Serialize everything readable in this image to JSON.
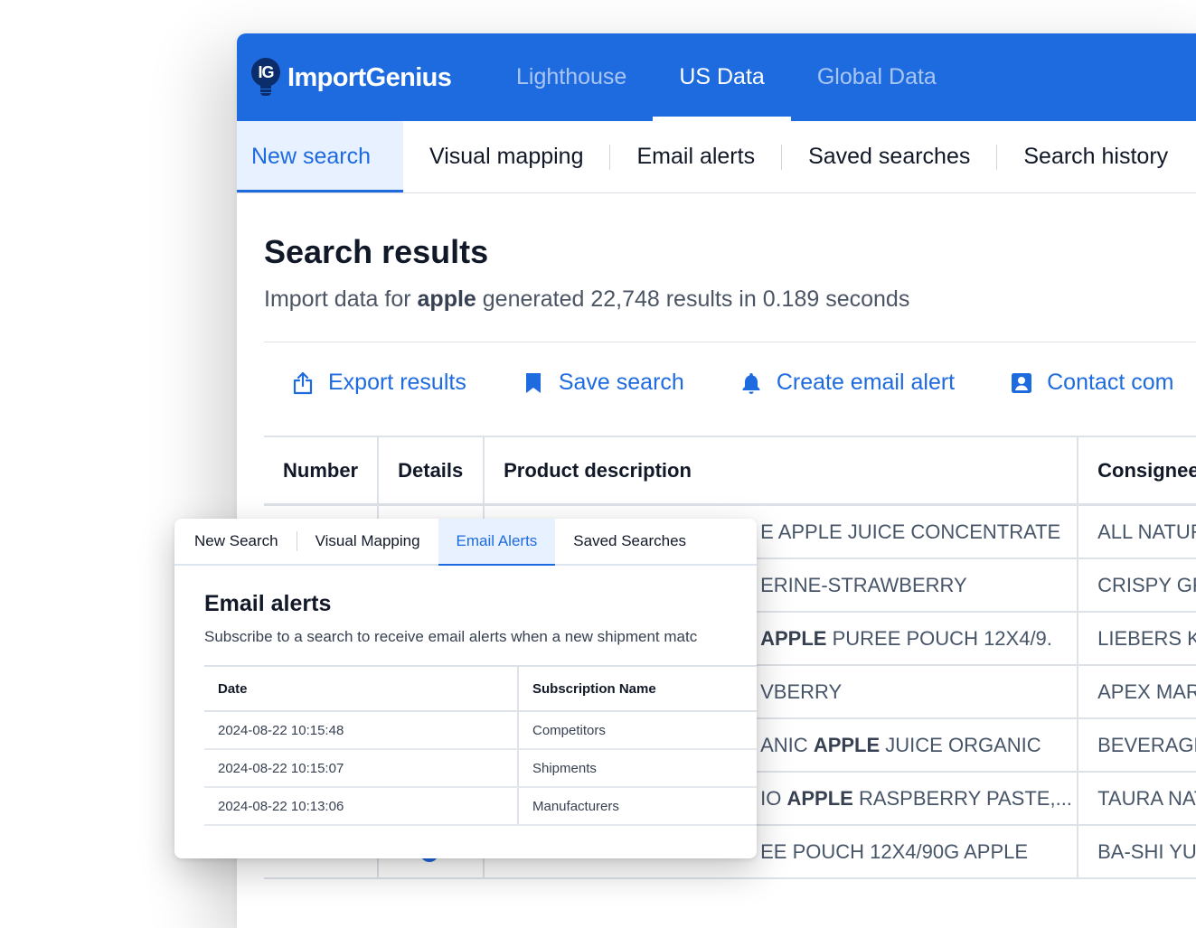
{
  "app": {
    "brand": "ImportGenius",
    "logo_mark": "IG",
    "accent_color": "#1e6be0",
    "top_nav": [
      {
        "label": "Lighthouse",
        "active": false
      },
      {
        "label": "US Data",
        "active": true
      },
      {
        "label": "Global Data",
        "active": false
      }
    ],
    "sub_nav": [
      {
        "label": "New search",
        "active": true
      },
      {
        "label": "Visual mapping",
        "active": false
      },
      {
        "label": "Email alerts",
        "active": false
      },
      {
        "label": "Saved searches",
        "active": false
      },
      {
        "label": "Search history",
        "active": false
      }
    ]
  },
  "results": {
    "title": "Search results",
    "summary_prefix": "Import data for ",
    "query": "apple",
    "summary_suffix": " generated 22,748 results in 0.189 seconds",
    "actions": [
      {
        "label": "Export results",
        "icon": "export-icon"
      },
      {
        "label": "Save search",
        "icon": "bookmark-icon"
      },
      {
        "label": "Create email alert",
        "icon": "bell-icon"
      },
      {
        "label": "Contact com",
        "icon": "contact-icon"
      }
    ],
    "columns": [
      "Number",
      "Details",
      "Product description",
      "Consignee"
    ],
    "rows": [
      {
        "desc_pre": "E APPLE JUICE CONCENTRATE",
        "desc_bold": "",
        "desc_post": "",
        "consignee": "ALL NATURA"
      },
      {
        "desc_pre": "ERINE-STRAWBERRY",
        "desc_bold": "",
        "desc_post": "",
        "consignee": "CRISPY GRE"
      },
      {
        "desc_pre": "",
        "desc_bold": "APPLE",
        "desc_post": " PUREE POUCH 12X4/9.",
        "consignee": "LIEBERS KO"
      },
      {
        "desc_pre": "VBERRY",
        "desc_bold": "",
        "desc_post": "",
        "consignee": "APEX MARI"
      },
      {
        "desc_pre": "ANIC ",
        "desc_bold": "APPLE",
        "desc_post": " JUICE ORGANIC",
        "consignee": "BEVERAGE I"
      },
      {
        "desc_pre": "IO ",
        "desc_bold": "APPLE",
        "desc_post": " RASPBERRY PASTE,...",
        "consignee": "TAURA NAT"
      },
      {
        "desc_pre": "EE POUCH 12X4/90G APPLE",
        "desc_bold": "",
        "desc_post": "",
        "consignee": "BA-SHI YUE"
      }
    ]
  },
  "alerts_card": {
    "tabs": [
      {
        "label": "New Search",
        "active": false
      },
      {
        "label": "Visual Mapping",
        "active": false
      },
      {
        "label": "Email Alerts",
        "active": true
      },
      {
        "label": "Saved Searches",
        "active": false
      }
    ],
    "title": "Email alerts",
    "subtitle": "Subscribe to a search to receive email alerts when a new shipment matc",
    "columns": [
      "Date",
      "Subscription Name"
    ],
    "rows": [
      {
        "date": "2024-08-22 10:15:48",
        "name": "Competitors"
      },
      {
        "date": "2024-08-22 10:15:07",
        "name": "Shipments"
      },
      {
        "date": "2024-08-22 10:13:06",
        "name": "Manufacturers"
      }
    ]
  }
}
